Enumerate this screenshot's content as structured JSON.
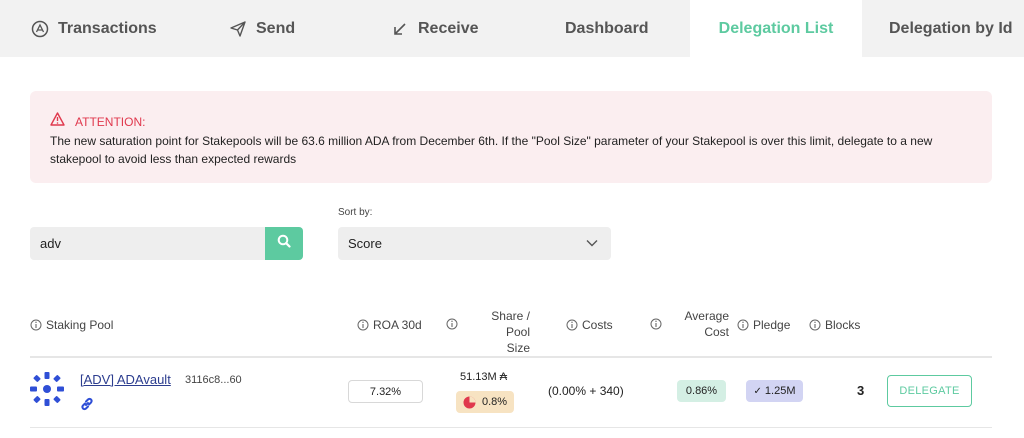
{
  "tabs": [
    {
      "label": "Transactions",
      "icon": "ada-coin-icon"
    },
    {
      "label": "Send",
      "icon": "paper-plane-icon"
    },
    {
      "label": "Receive",
      "icon": "arrow-down-left-icon"
    },
    {
      "label": "Dashboard"
    },
    {
      "label": "Delegation List",
      "active": true
    },
    {
      "label": "Delegation by Id"
    }
  ],
  "alert": {
    "title": "ATTENTION:",
    "body": "The new saturation point for Stakepools will be 63.6 million ADA from December 6th. If the \"Pool Size\" parameter of your Stakepool is over this limit, delegate to a new stakepool to avoid less than expected rewards",
    "icon": "warning-triangle-icon"
  },
  "search": {
    "value": "adv",
    "icon": "search-icon"
  },
  "sort": {
    "label": "Sort by:",
    "selected": "Score"
  },
  "table": {
    "headers": {
      "pool": "Staking Pool",
      "roa": "ROA 30d",
      "share_line1": "Share /",
      "share_line2": "Pool Size",
      "costs": "Costs",
      "avg_line1": "Average",
      "avg_line2": "Cost",
      "pledge": "Pledge",
      "blocks": "Blocks"
    },
    "rows": [
      {
        "ticker_name": "[ADV] ADAvault",
        "pool_id": "3116c8...60",
        "roa": "7.32%",
        "pool_size": "51.13M ₳",
        "share": "0.8%",
        "costs": "(0.00% + 340)",
        "avg_cost": "0.86%",
        "pledge": "1.25M",
        "blocks": "3",
        "action": "DELEGATE"
      }
    ]
  },
  "colors": {
    "accent": "#5dcaa0",
    "alert_bg": "#fbeef0",
    "alert_text": "#e0384d",
    "link": "#2c3d8f"
  }
}
